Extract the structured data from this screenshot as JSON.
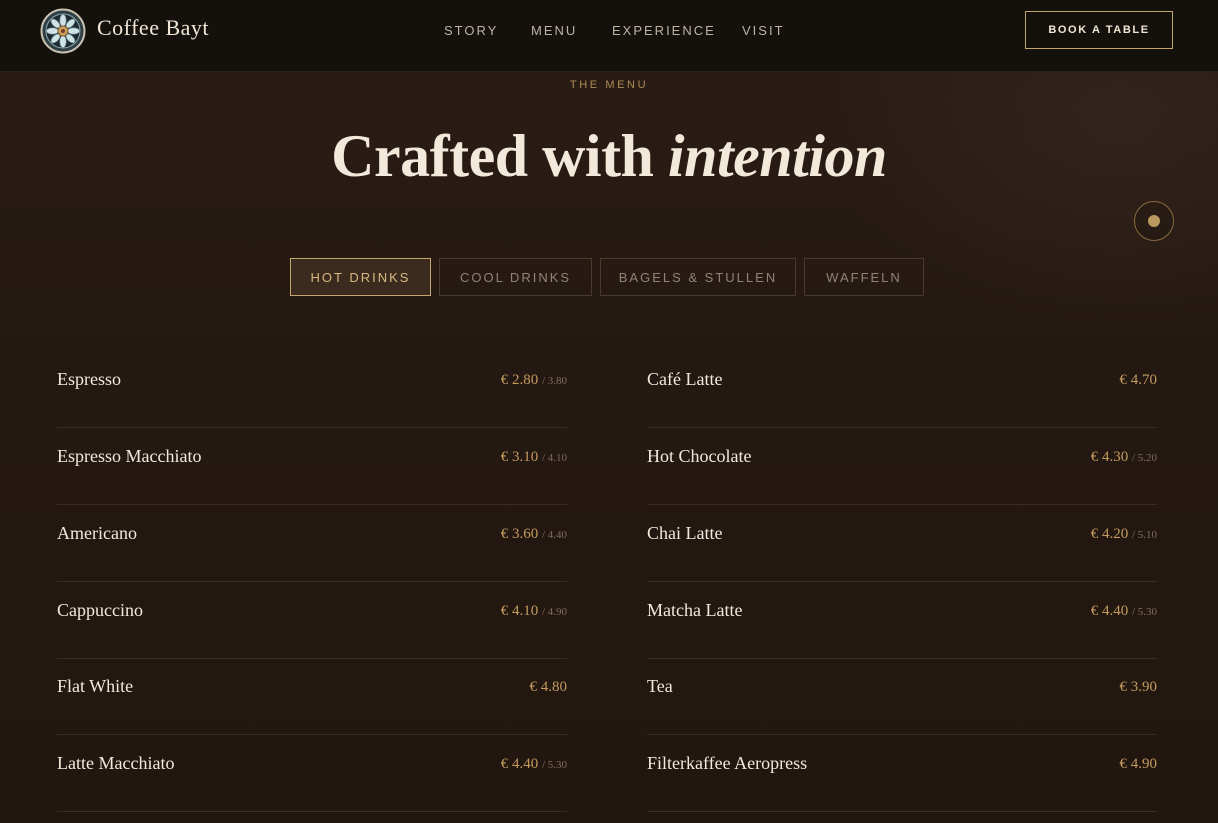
{
  "nav": {
    "brand": "Coffee Bayt",
    "links": [
      "STORY",
      "MENU",
      "EXPERIENCE",
      "VISIT"
    ],
    "cta": "BOOK A TABLE"
  },
  "hero": {
    "eyebrow": "THE MENU",
    "title_plain": "Crafted with",
    "title_italic": "intention"
  },
  "tabs": [
    "HOT DRINKS",
    "COOL DRINKS",
    "BAGELS & STULLEN",
    "WAFFELN"
  ],
  "active_tab": "HOT DRINKS",
  "menu": {
    "left": [
      {
        "name": "Espresso",
        "price": "€ 2.80",
        "alt": "/ 3.80"
      },
      {
        "name": "Espresso Macchiato",
        "price": "€ 3.10",
        "alt": "/ 4.10"
      },
      {
        "name": "Americano",
        "price": "€ 3.60",
        "alt": "/ 4.40"
      },
      {
        "name": "Cappuccino",
        "price": "€ 4.10",
        "alt": "/ 4.90"
      },
      {
        "name": "Flat White",
        "price": "€ 4.80",
        "alt": ""
      },
      {
        "name": "Latte Macchiato",
        "price": "€ 4.40",
        "alt": "/ 5.30"
      }
    ],
    "right": [
      {
        "name": "Café Latte",
        "price": "€ 4.70",
        "alt": ""
      },
      {
        "name": "Hot Chocolate",
        "price": "€ 4.30",
        "alt": "/ 5.20"
      },
      {
        "name": "Chai Latte",
        "price": "€ 4.20",
        "alt": "/ 5.10"
      },
      {
        "name": "Matcha Latte",
        "price": "€ 4.40",
        "alt": "/ 5.30"
      },
      {
        "name": "Tea",
        "price": "€ 3.90",
        "alt": ""
      },
      {
        "name": "Filterkaffee Aeropress",
        "price": "€ 4.90",
        "alt": ""
      }
    ]
  },
  "colors": {
    "accent": "#c5a46d",
    "background": "#241912",
    "nav_background": "#14110d",
    "price": "#c49a5f"
  },
  "icons": {
    "logo": "mandala-logo-icon",
    "floating": "dot-icon"
  }
}
